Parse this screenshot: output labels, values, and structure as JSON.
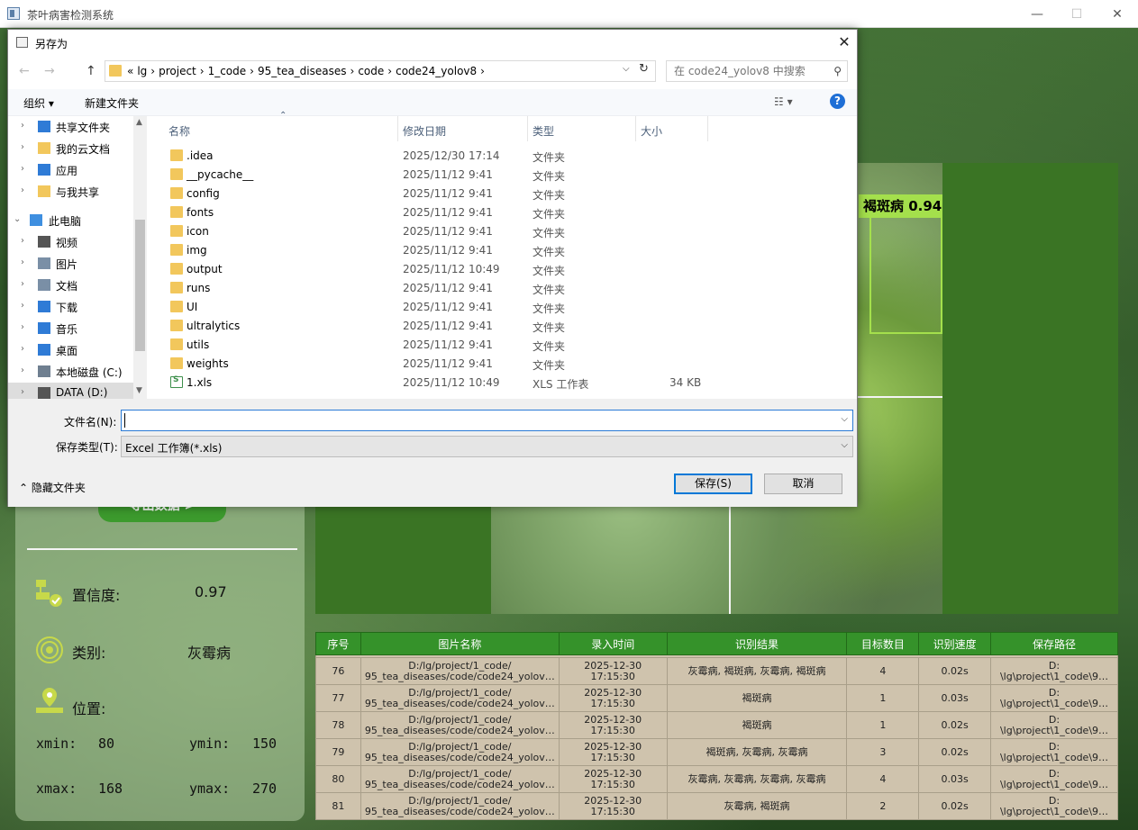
{
  "app": {
    "title": "茶叶病害检测系统",
    "minimize": "—",
    "maximize": "☐",
    "close": "✕"
  },
  "left_panel": {
    "export_label": "导出数据 >",
    "confidence_label": "置信度:",
    "confidence_value": "0.97",
    "class_label": "类别:",
    "class_value": "灰霉病",
    "position_label": "位置:",
    "xmin_label": "xmin:",
    "xmin_value": "80",
    "ymin_label": "ymin:",
    "ymin_value": "150",
    "xmax_label": "xmax:",
    "xmax_value": "168",
    "ymax_label": "ymax:",
    "ymax_value": "270"
  },
  "detection": {
    "label": "褐斑病 0.94",
    "color": "#a4e04c"
  },
  "table": {
    "headers": [
      "序号",
      "图片名称",
      "录入时间",
      "识别结果",
      "目标数目",
      "识别速度",
      "保存路径"
    ],
    "rows": [
      {
        "id": "76",
        "name1": "D:/lg/project/1_code/",
        "name2": "95_tea_diseases/code/code24_yolov…",
        "time1": "2025-12-30",
        "time2": "17:15:30",
        "result": "灰霉病, 褐斑病, 灰霉病, 褐斑病",
        "count": "4",
        "speed": "0.02s",
        "path1": "D:",
        "path2": "\\lg\\project\\1_code\\9…"
      },
      {
        "id": "77",
        "name1": "D:/lg/project/1_code/",
        "name2": "95_tea_diseases/code/code24_yolov…",
        "time1": "2025-12-30",
        "time2": "17:15:30",
        "result": "褐斑病",
        "count": "1",
        "speed": "0.03s",
        "path1": "D:",
        "path2": "\\lg\\project\\1_code\\9…"
      },
      {
        "id": "78",
        "name1": "D:/lg/project/1_code/",
        "name2": "95_tea_diseases/code/code24_yolov…",
        "time1": "2025-12-30",
        "time2": "17:15:30",
        "result": "褐斑病",
        "count": "1",
        "speed": "0.02s",
        "path1": "D:",
        "path2": "\\lg\\project\\1_code\\9…"
      },
      {
        "id": "79",
        "name1": "D:/lg/project/1_code/",
        "name2": "95_tea_diseases/code/code24_yolov…",
        "time1": "2025-12-30",
        "time2": "17:15:30",
        "result": "褐斑病, 灰霉病, 灰霉病",
        "count": "3",
        "speed": "0.02s",
        "path1": "D:",
        "path2": "\\lg\\project\\1_code\\9…"
      },
      {
        "id": "80",
        "name1": "D:/lg/project/1_code/",
        "name2": "95_tea_diseases/code/code24_yolov…",
        "time1": "2025-12-30",
        "time2": "17:15:30",
        "result": "灰霉病, 灰霉病, 灰霉病, 灰霉病",
        "count": "4",
        "speed": "0.03s",
        "path1": "D:",
        "path2": "\\lg\\project\\1_code\\9…"
      },
      {
        "id": "81",
        "name1": "D:/lg/project/1_code/",
        "name2": "95_tea_diseases/code/code24_yolov…",
        "time1": "2025-12-30",
        "time2": "17:15:30",
        "result": "灰霉病, 褐斑病",
        "count": "2",
        "speed": "0.02s",
        "path1": "D:",
        "path2": "\\lg\\project\\1_code\\9…"
      }
    ]
  },
  "dialog": {
    "title": "另存为",
    "close": "✕",
    "back": "←",
    "forward": "→",
    "up": "↑",
    "breadcrumbs": [
      "«",
      "lg",
      "›",
      "project",
      "›",
      "1_code",
      "›",
      "95_tea_diseases",
      "›",
      "code",
      "›",
      "code24_yolov8",
      "›"
    ],
    "address_dropdown": "⌵",
    "refresh": "↻",
    "search_placeholder": "在 code24_yolov8 中搜索",
    "search_icon": "⚲",
    "organize_label": "组织 ▾",
    "new_folder_label": "新建文件夹",
    "view_label": "☷ ▾",
    "help_label": "?",
    "nav_items": [
      {
        "label": "共享文件夹",
        "chev": "›",
        "icon_color": "#2f7bd6"
      },
      {
        "label": "我的云文档",
        "chev": "›",
        "icon_color": "#f2c75c"
      },
      {
        "label": "应用",
        "chev": "›",
        "icon_color": "#2f7bd6"
      },
      {
        "label": "与我共享",
        "chev": "›",
        "icon_color": "#f2c75c"
      },
      {
        "label": "此电脑",
        "chev": "⌄",
        "icon_color": "#3f8fe0"
      },
      {
        "label": "视频",
        "chev": "›",
        "icon_color": "#555555"
      },
      {
        "label": "图片",
        "chev": "›",
        "icon_color": "#7a8fa6"
      },
      {
        "label": "文档",
        "chev": "›",
        "icon_color": "#7a8fa6"
      },
      {
        "label": "下载",
        "chev": "›",
        "icon_color": "#2f7bd6"
      },
      {
        "label": "音乐",
        "chev": "›",
        "icon_color": "#2f7bd6"
      },
      {
        "label": "桌面",
        "chev": "›",
        "icon_color": "#2f7bd6"
      },
      {
        "label": "本地磁盘 (C:)",
        "chev": "›",
        "icon_color": "#6f7f90"
      },
      {
        "label": "DATA (D:)",
        "chev": "›",
        "icon_color": "#555555"
      }
    ],
    "columns": [
      "名称",
      "修改日期",
      "类型",
      "大小"
    ],
    "sort_indicator": "⌃",
    "files": [
      {
        "name": ".idea",
        "date": "2025/12/30 17:14",
        "type": "文件夹",
        "size": ""
      },
      {
        "name": "__pycache__",
        "date": "2025/11/12 9:41",
        "type": "文件夹",
        "size": ""
      },
      {
        "name": "config",
        "date": "2025/11/12 9:41",
        "type": "文件夹",
        "size": ""
      },
      {
        "name": "fonts",
        "date": "2025/11/12 9:41",
        "type": "文件夹",
        "size": ""
      },
      {
        "name": "icon",
        "date": "2025/11/12 9:41",
        "type": "文件夹",
        "size": ""
      },
      {
        "name": "img",
        "date": "2025/11/12 9:41",
        "type": "文件夹",
        "size": ""
      },
      {
        "name": "output",
        "date": "2025/11/12 10:49",
        "type": "文件夹",
        "size": ""
      },
      {
        "name": "runs",
        "date": "2025/11/12 9:41",
        "type": "文件夹",
        "size": ""
      },
      {
        "name": "UI",
        "date": "2025/11/12 9:41",
        "type": "文件夹",
        "size": ""
      },
      {
        "name": "ultralytics",
        "date": "2025/11/12 9:41",
        "type": "文件夹",
        "size": ""
      },
      {
        "name": "utils",
        "date": "2025/11/12 9:41",
        "type": "文件夹",
        "size": ""
      },
      {
        "name": "weights",
        "date": "2025/11/12 9:41",
        "type": "文件夹",
        "size": ""
      },
      {
        "name": "1.xls",
        "date": "2025/11/12 10:49",
        "type": "XLS 工作表",
        "size": "34 KB"
      }
    ],
    "filename_label": "文件名(N):",
    "filename_value": "",
    "filetype_label": "保存类型(T):",
    "filetype_value": "Excel 工作簿(*.xls)",
    "dropdown_arrow": "⌵",
    "hide_folders_label": "⌃  隐藏文件夹",
    "save_label": "保存(S)",
    "cancel_label": "取消"
  }
}
